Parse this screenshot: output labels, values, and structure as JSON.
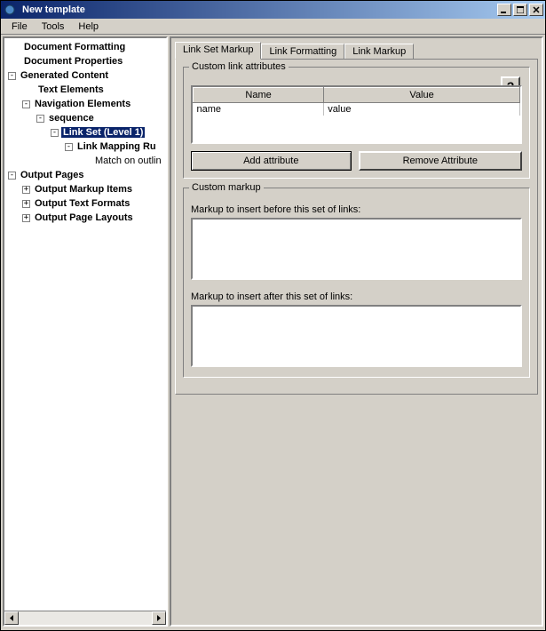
{
  "window": {
    "title": "New template"
  },
  "menu": {
    "file": "File",
    "tools": "Tools",
    "help": "Help"
  },
  "tree": {
    "doc_formatting": "Document Formatting",
    "doc_properties": "Document Properties",
    "generated_content": "Generated Content",
    "text_elements": "Text Elements",
    "navigation_elements": "Navigation Elements",
    "sequence": "sequence",
    "link_set": "Link Set (Level 1)",
    "link_mapping": "Link Mapping Ru",
    "match_outline": "Match on outlin",
    "output_pages": "Output Pages",
    "output_markup_items": "Output Markup Items",
    "output_text_formats": "Output Text Formats",
    "output_page_layouts": "Output Page Layouts"
  },
  "tabs": {
    "link_set_markup": "Link Set Markup",
    "link_formatting": "Link Formatting",
    "link_markup": "Link Markup"
  },
  "group1": {
    "title": "Custom link attributes",
    "col_name": "Name",
    "col_value": "Value",
    "row_name": "name",
    "row_value": "value",
    "add_btn": "Add attribute",
    "remove_btn": "Remove Attribute",
    "help": "?"
  },
  "group2": {
    "title": "Custom markup",
    "before_label": "Markup to insert before this set of links:",
    "after_label": "Markup to insert after this set of links:"
  }
}
